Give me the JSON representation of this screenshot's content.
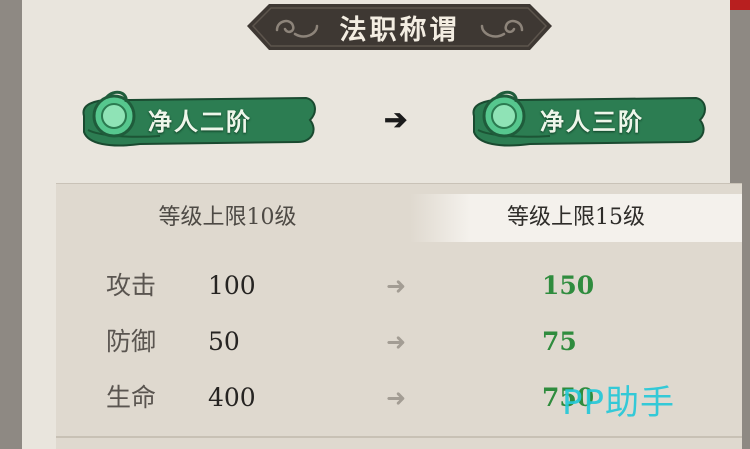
{
  "title": "法职称谓",
  "rank_current": "净人二阶",
  "rank_next": "净人三阶",
  "level_cap": {
    "current": "等级上限10级",
    "next": "等级上限15级"
  },
  "stats": [
    {
      "name": "攻击",
      "current": "100",
      "next": "150"
    },
    {
      "name": "防御",
      "current": "50",
      "next": "75"
    },
    {
      "name": "生命",
      "current": "400",
      "next": "750"
    }
  ],
  "watermark": "PP助手",
  "colors": {
    "next_value": "#2f8c3e",
    "badge_green": "#2c7d52",
    "title_plate": "#3e3833"
  }
}
